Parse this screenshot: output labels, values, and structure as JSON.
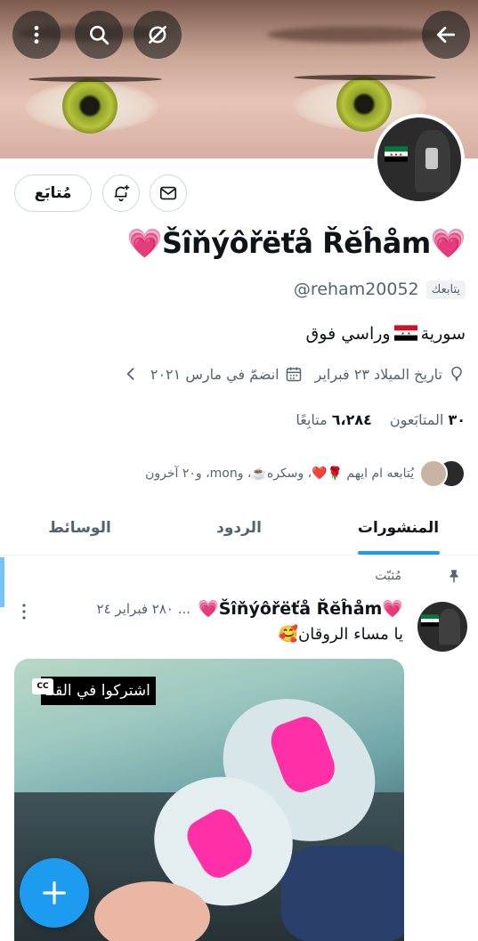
{
  "header": {
    "back_icon": "arrow-left-icon",
    "search_icon": "search-icon",
    "more_icon": "more-vertical-icon",
    "mute_icon": "circle-slash-icon"
  },
  "profile": {
    "name": "💗Šîňýôřëťå Řĕĥåm💗",
    "handle": "@reham20052",
    "follows_you": "يتابعك",
    "bio": {
      "before": "سورية",
      "after": "وراسي فوق"
    },
    "birthday": "تاريخ الميلاد ٢٣ فبراير",
    "joined": "انضمّ في مارس ٢٠٢١",
    "following_count": "٣٠",
    "following_label": "المتابَعون",
    "followers_count": "٦،٢٨٤",
    "followers_label": "متابِعًا",
    "followed_by": "يُتابعه ام ايهم 🌹❤️، وسكره☕️، وmon، و٢٠ آخرون"
  },
  "actions": {
    "follow_label": "مُتابَع"
  },
  "tabs": [
    {
      "label": "المنشورات"
    },
    {
      "label": "الردود"
    },
    {
      "label": "الوسائط"
    }
  ],
  "tweet": {
    "pinned_label": "مُثبّت",
    "name": "💗Šîňýôřëťå Řĕĥåm💗",
    "meta": "... ٢٨٠ فبراير ٢٤",
    "text": "يا مساء الروقان🥰",
    "caption": "اشتركوا في القنـ",
    "cc_label": "CC"
  },
  "colors": {
    "accent": "#1d9bf0",
    "text_primary": "#0f1419",
    "text_secondary": "#536471"
  }
}
